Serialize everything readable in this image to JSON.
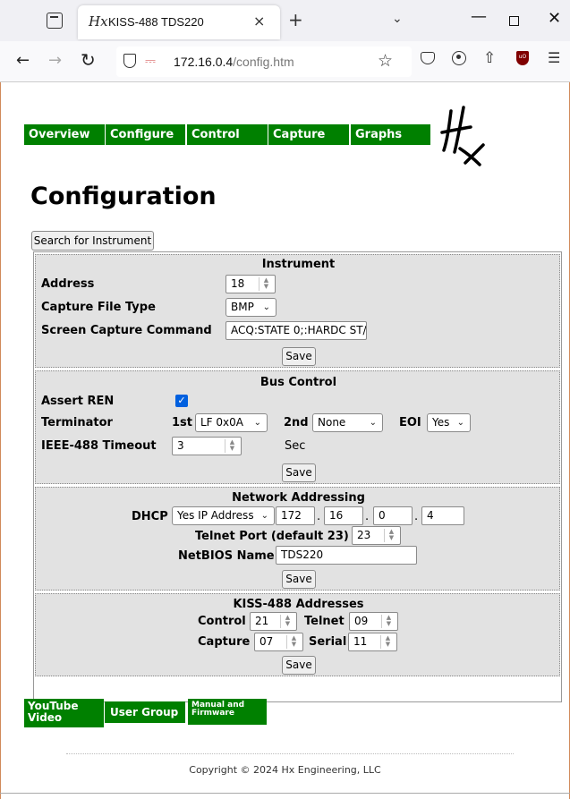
{
  "browser": {
    "tab_icon": "Hx",
    "tab_title": "KISS-488 TDS220",
    "tab_close": "×",
    "new_tab": "+",
    "url_host": "172.16.0.4",
    "url_path": "/config.htm",
    "icons": [
      "tab-list-icon",
      "back-icon",
      "forward-icon",
      "reload-icon",
      "shield-icon",
      "lock-icon",
      "star-icon",
      "pocket-icon",
      "account-icon",
      "extensions-icon",
      "ublock-icon",
      "menu-icon",
      "minimize-icon",
      "maximize-icon",
      "close-icon"
    ]
  },
  "nav": {
    "overview": "Overview",
    "configure": "Configure",
    "control": "Control",
    "capture": "Capture",
    "graphs": "Graphs"
  },
  "page_title": "Configuration",
  "search_button": "Search for Instrument",
  "instrument": {
    "title": "Instrument",
    "address_label": "Address",
    "address_value": "18",
    "capture_type_label": "Capture File Type",
    "capture_type_value": "BMP",
    "screen_cmd_label": "Screen Capture Command",
    "screen_cmd_value": "ACQ:STATE 0;:HARDC ST/",
    "save": "Save"
  },
  "bus": {
    "title": "Bus Control",
    "assert_ren_label": "Assert REN",
    "assert_ren_checked": true,
    "terminator_label": "Terminator",
    "first_label": "1st",
    "first_value": "LF 0x0A",
    "second_label": "2nd",
    "second_value": "None",
    "eoi_label": "EOI",
    "eoi_value": "Yes",
    "timeout_label": "IEEE-488 Timeout",
    "timeout_value": "3",
    "timeout_unit": "Sec",
    "save": "Save"
  },
  "network": {
    "title": "Network Addressing",
    "dhcp_label": "DHCP",
    "dhcp_value": "Yes IP Address",
    "ip1": "172",
    "ip2": "16",
    "ip3": "0",
    "ip4": "4",
    "dot": ".",
    "telnet_label": "Telnet Port (default 23)",
    "telnet_value": "23",
    "netbios_label": "NetBIOS Name",
    "netbios_value": "TDS220",
    "save": "Save"
  },
  "kiss": {
    "title": "KISS-488 Addresses",
    "control_label": "Control",
    "control_value": "21",
    "telnet_label": "Telnet",
    "telnet_value": "09",
    "capture_label": "Capture",
    "capture_value": "07",
    "serial_label": "Serial",
    "serial_value": "11",
    "save": "Save"
  },
  "footer": {
    "youtube_line1": "YouTube",
    "youtube_line2": "Video",
    "user_group": "User Group",
    "manual_line1": "Manual and",
    "manual_line2": "Firmware",
    "copyright": "Copyright © 2024 Hx Engineering, LLC"
  },
  "colors": {
    "nav_green": "#008000",
    "section_bg": "#e2e2e2",
    "checkbox_blue": "#0060df"
  }
}
